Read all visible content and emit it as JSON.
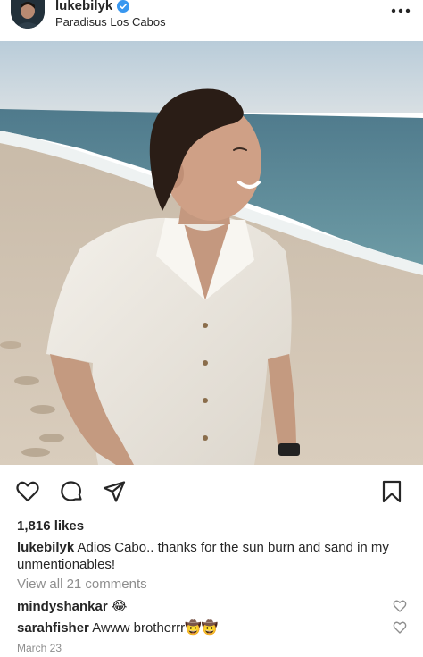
{
  "post": {
    "username": "lukebilyk",
    "location": "Paradisus Los Cabos",
    "likes": "1,816 likes",
    "caption_user": "lukebilyk",
    "caption_text": "Adios Cabo.. thanks for the sun burn and sand in my unmentionables!",
    "view_comments": "View all 21 comments",
    "date": "March 23"
  },
  "comments": [
    {
      "user": "mindyshankar",
      "text": "😂"
    },
    {
      "user": "sarahfisher",
      "text": "Awww brotherrr🤠🤠"
    }
  ],
  "icons": {
    "verified": "verified-badge-icon",
    "more": "more-options-icon",
    "like": "heart-icon",
    "comment": "comment-bubble-icon",
    "share": "paper-plane-icon",
    "save": "bookmark-icon"
  },
  "colors": {
    "verified_blue": "#3897f0",
    "text": "#262626",
    "muted": "#8e8e8e"
  }
}
